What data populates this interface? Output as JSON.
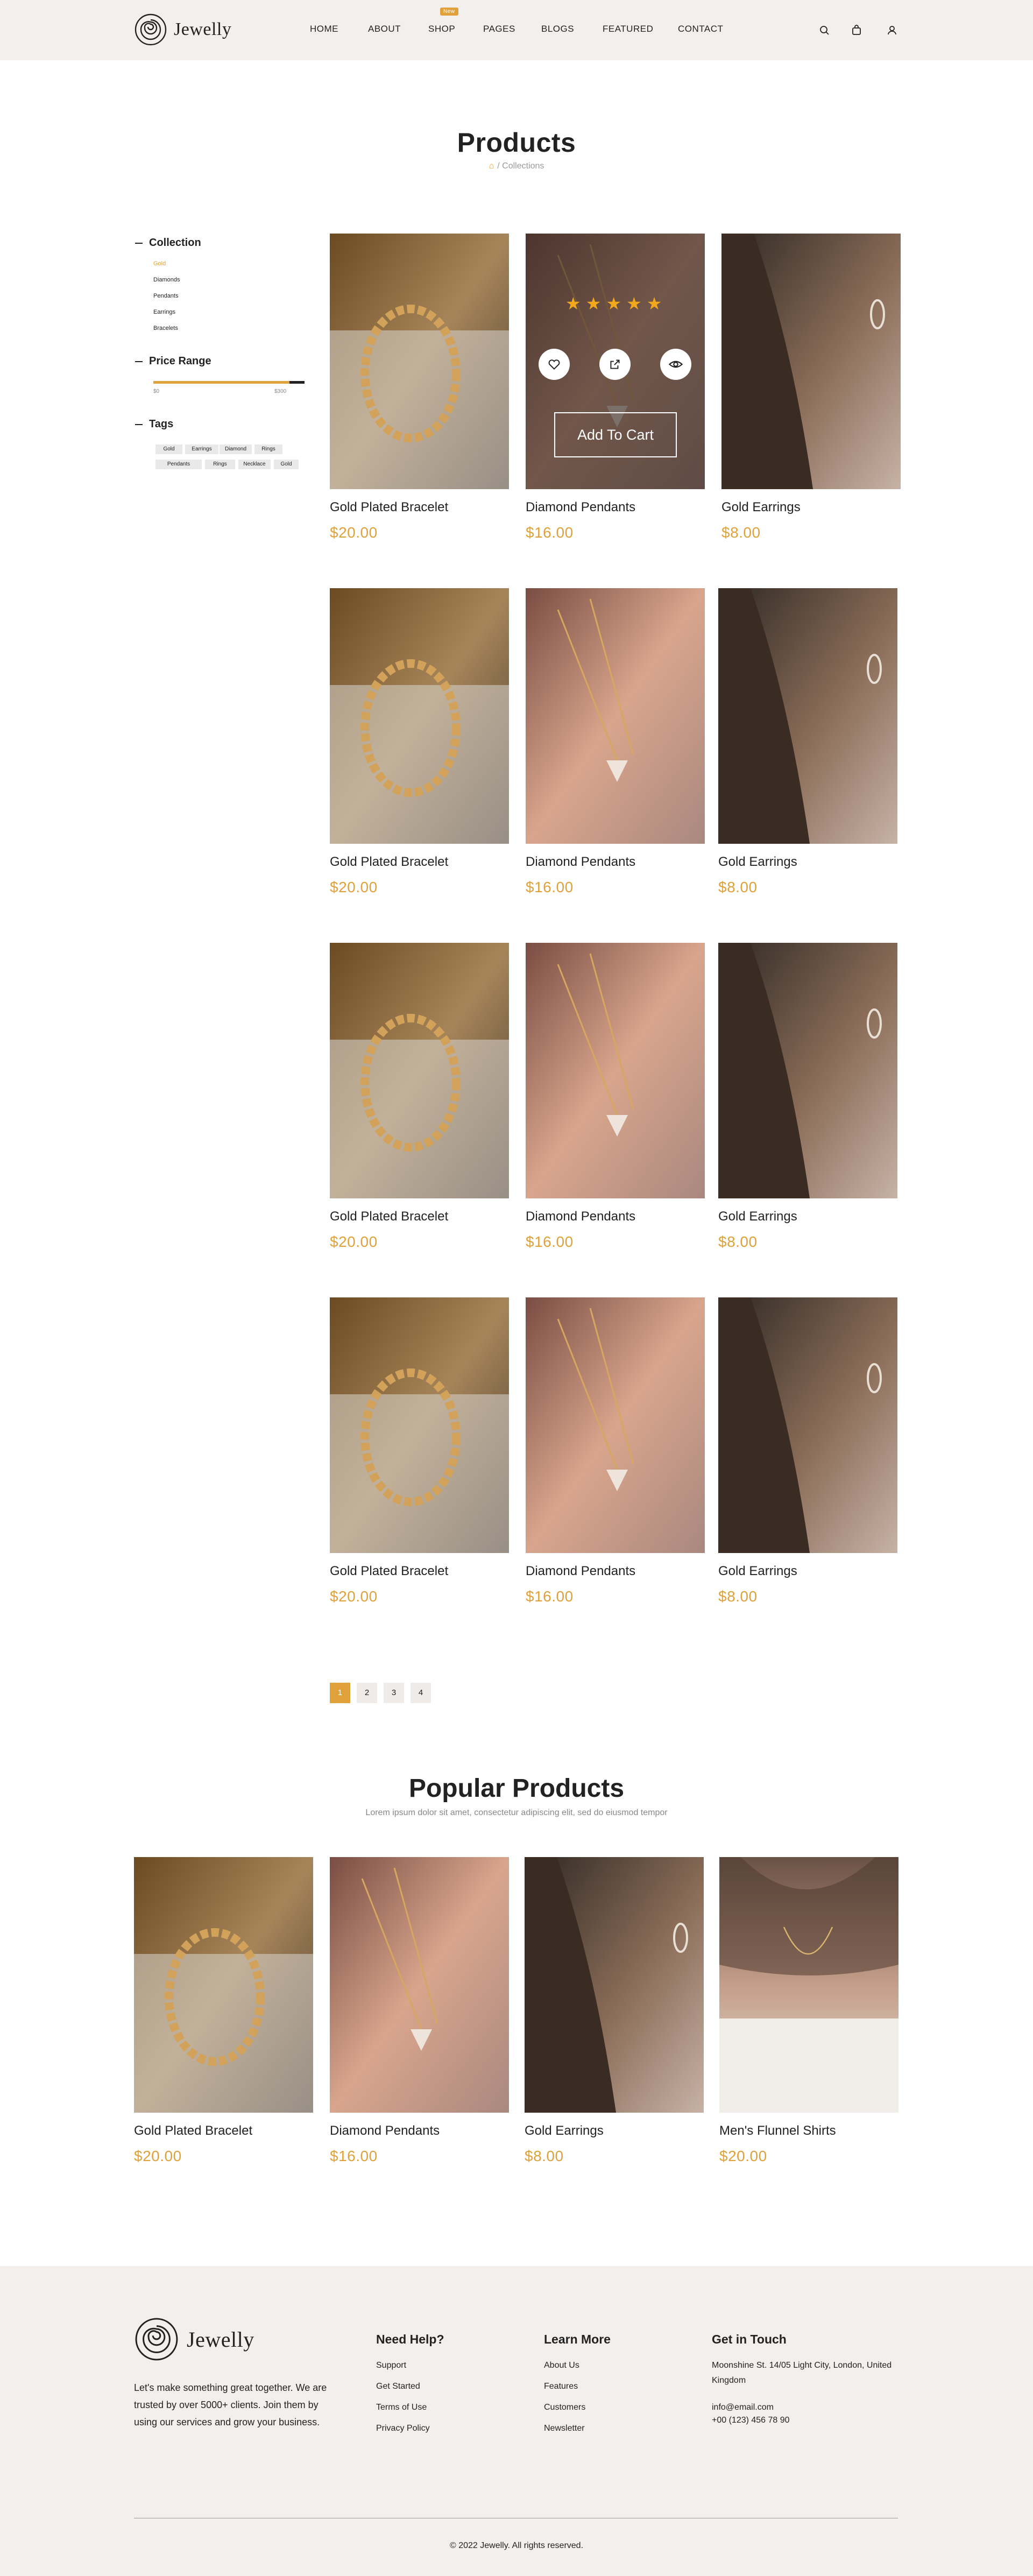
{
  "brand": {
    "name": "Jewelly"
  },
  "nav": {
    "items": [
      "HOME",
      "ABOUT",
      "SHOP",
      "PAGES",
      "BLOGS",
      "FEATURED",
      "CONTACT"
    ],
    "badge": "New"
  },
  "header_icons": [
    "search-icon",
    "shopping-bag-icon",
    "user-icon"
  ],
  "page": {
    "title": "Products",
    "breadcrumb_current": "Collections",
    "breadcrumb_separator": "/"
  },
  "sidebar": {
    "collection_heading": "Collection",
    "collections": [
      "Gold",
      "Diamonds",
      "Pendants",
      "Earrings",
      "Bracelets"
    ],
    "price_heading": "Price Range",
    "price_min": "$0",
    "price_max": "$300",
    "tags_heading": "Tags",
    "tags": [
      "Gold",
      "Earrings",
      "Diamond",
      "Rings",
      "Pendants",
      "Rings",
      "Necklace",
      "Gold"
    ]
  },
  "products": [
    {
      "name": "Gold Plated Bracelet",
      "price": "$20.00"
    },
    {
      "name": "Diamond Pendants",
      "price": "$16.00"
    },
    {
      "name": "Gold Earrings",
      "price": "$8.00"
    },
    {
      "name": "Gold Plated Bracelet",
      "price": "$20.00"
    },
    {
      "name": "Diamond Pendants",
      "price": "$16.00"
    },
    {
      "name": "Gold Earrings",
      "price": "$8.00"
    },
    {
      "name": "Gold Plated Bracelet",
      "price": "$20.00"
    },
    {
      "name": "Diamond Pendants",
      "price": "$16.00"
    },
    {
      "name": "Gold Earrings",
      "price": "$8.00"
    },
    {
      "name": "Gold Plated Bracelet",
      "price": "$20.00"
    },
    {
      "name": "Diamond Pendants",
      "price": "$16.00"
    },
    {
      "name": "Gold Earrings",
      "price": "$8.00"
    }
  ],
  "hover_card": {
    "rating": 5,
    "add_to_cart": "Add To Cart"
  },
  "pagination": [
    "1",
    "2",
    "3",
    "4"
  ],
  "popular": {
    "title": "Popular Products",
    "subtitle": "Lorem ipsum dolor sit amet, consectetur adipiscing elit, sed do eiusmod tempor",
    "items": [
      {
        "name": "Gold Plated Bracelet",
        "price": "$20.00"
      },
      {
        "name": "Diamond Pendants",
        "price": "$16.00"
      },
      {
        "name": "Gold Earrings",
        "price": "$8.00"
      },
      {
        "name": "Men's Flunnel Shirts",
        "price": "$20.00"
      }
    ]
  },
  "footer": {
    "description": "Let's make something great together. We are trusted by over 5000+ clients. Join them by using our services and grow your business.",
    "help_title": "Need Help?",
    "help_links": [
      "Support",
      "Get Started",
      "Terms of Use",
      "Privacy Policy"
    ],
    "learn_title": "Learn More",
    "learn_links": [
      "About Us",
      "Features",
      "Customers",
      "Newsletter"
    ],
    "contact_title": "Get in Touch",
    "address": "Moonshine St. 14/05 Light City, London, United Kingdom",
    "email": "info@email.com",
    "phone": "+00 (123) 456 78 90",
    "copyright": "© 2022 Jewelly. All rights reserved."
  },
  "colors": {
    "accent": "#e0a13a",
    "header_bg": "#f3efec",
    "text": "#222222"
  }
}
